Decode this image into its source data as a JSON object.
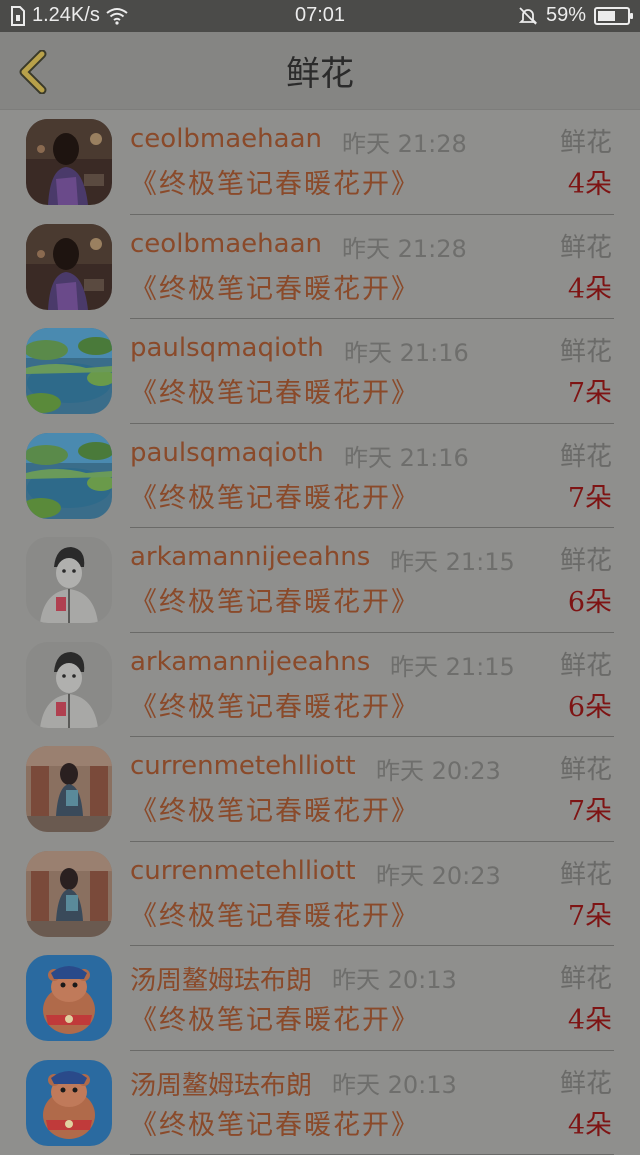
{
  "status_bar": {
    "speed": "1.24K/s",
    "time": "07:01",
    "battery": "59%",
    "battery_level": 0.59
  },
  "nav": {
    "title": "鲜花"
  },
  "list": [
    {
      "user": "ceolbmaehaan",
      "time": "昨天 21:28",
      "gift": "鲜花",
      "book": "《终极笔记春暖花开》",
      "count": "4朵",
      "avatar": "girl-night-photo"
    },
    {
      "user": "ceolbmaehaan",
      "time": "昨天 21:28",
      "gift": "鲜花",
      "book": "《终极笔记春暖花开》",
      "count": "4朵",
      "avatar": "girl-night-photo"
    },
    {
      "user": "paulsqmaqioth",
      "time": "昨天 21:16",
      "gift": "鲜花",
      "book": "《终极笔记春暖花开》",
      "count": "7朵",
      "avatar": "lake-landscape"
    },
    {
      "user": "paulsqmaqioth",
      "time": "昨天 21:16",
      "gift": "鲜花",
      "book": "《终极笔记春暖花开》",
      "count": "7朵",
      "avatar": "lake-landscape"
    },
    {
      "user": "arkamannijeeahns",
      "time": "昨天 21:15",
      "gift": "鲜花",
      "book": "《终极笔记春暖花开》",
      "count": "6朵",
      "avatar": "boy-sketch"
    },
    {
      "user": "arkamannijeeahns",
      "time": "昨天 21:15",
      "gift": "鲜花",
      "book": "《终极笔记春暖花开》",
      "count": "6朵",
      "avatar": "boy-sketch"
    },
    {
      "user": "currenmetehlliott",
      "time": "昨天 20:23",
      "gift": "鲜花",
      "book": "《终极笔记春暖花开》",
      "count": "7朵",
      "avatar": "girl-shop-photo"
    },
    {
      "user": "currenmetehlliott",
      "time": "昨天 20:23",
      "gift": "鲜花",
      "book": "《终极笔记春暖花开》",
      "count": "7朵",
      "avatar": "girl-shop-photo"
    },
    {
      "user": "汤周鳌姆珐布朗",
      "time": "昨天 20:13",
      "gift": "鲜花",
      "book": "《终极笔记春暖花开》",
      "count": "4朵",
      "avatar": "cartoon-bear"
    },
    {
      "user": "汤周鳌姆珐布朗",
      "time": "昨天 20:13",
      "gift": "鲜花",
      "book": "《终极笔记春暖花开》",
      "count": "4朵",
      "avatar": "cartoon-bear"
    }
  ]
}
